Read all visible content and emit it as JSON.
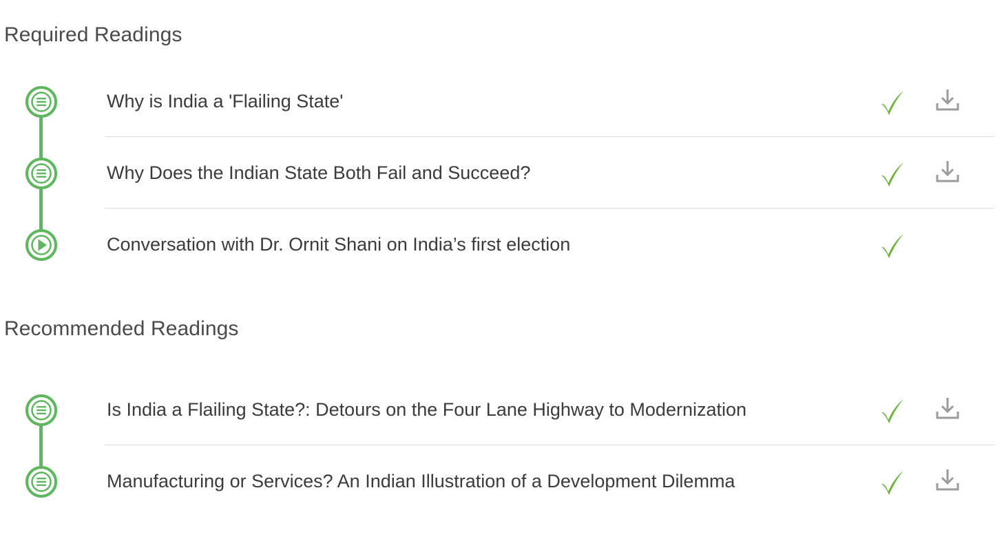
{
  "sections": [
    {
      "title": "Required Readings",
      "items": [
        {
          "type": "reading",
          "title": "Why is India a 'Flailing State'",
          "completed": true,
          "downloadable": true
        },
        {
          "type": "reading",
          "title": "Why Does the Indian State Both Fail and Succeed?",
          "completed": true,
          "downloadable": true
        },
        {
          "type": "video",
          "title": "Conversation with Dr. Ornit Shani on India’s first election",
          "completed": true,
          "downloadable": false
        }
      ]
    },
    {
      "title": "Recommended Readings",
      "items": [
        {
          "type": "reading",
          "title": "Is India a Flailing State?: Detours on the Four Lane Highway to Modernization",
          "completed": true,
          "downloadable": true
        },
        {
          "type": "reading",
          "title": "Manufacturing or Services? An Indian Illustration of a Development Dilemma",
          "completed": true,
          "downloadable": true
        }
      ]
    }
  ],
  "icons": {
    "reading": "reading-icon",
    "video": "play-icon",
    "completed": "checkmark-icon",
    "download": "download-icon"
  },
  "colors": {
    "accent": "#5cb85c",
    "check": "#6cb33f",
    "download": "#9a9a9a",
    "separator": "#dcdcdc",
    "text": "#3b3b3b"
  }
}
